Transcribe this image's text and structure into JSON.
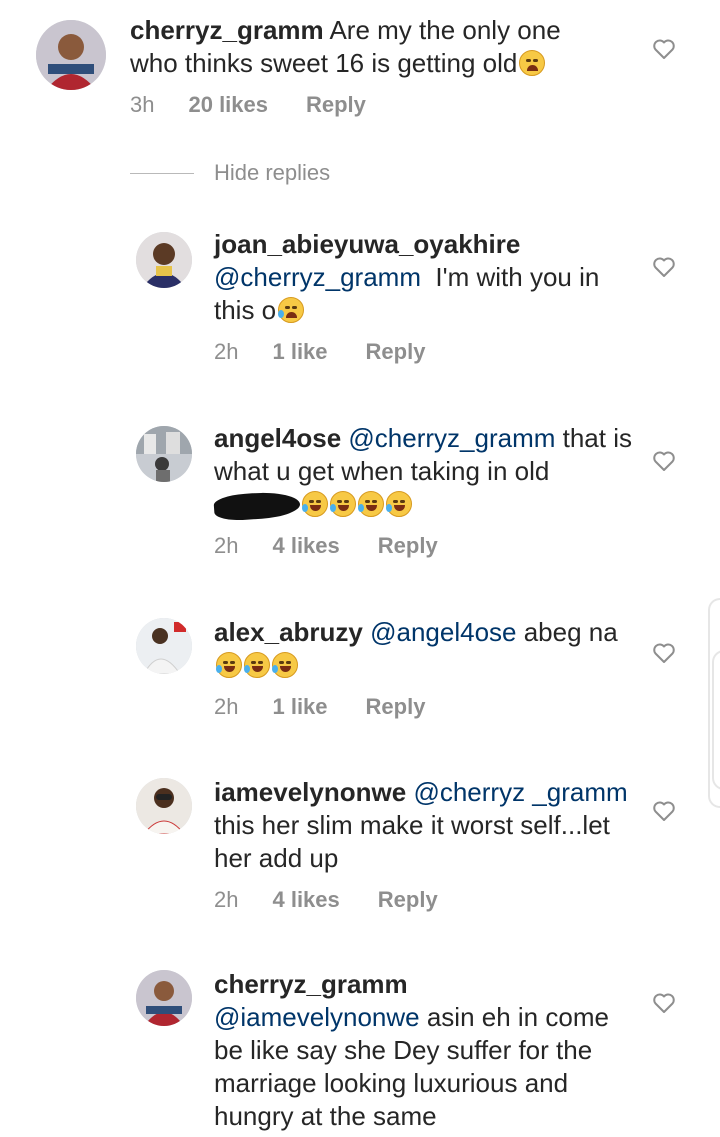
{
  "hide_replies": "Hide replies",
  "comments": [
    {
      "username": "cherryz_gramm",
      "mention": "",
      "text_before": " Are my the only one who thinks sweet 16 is getting old",
      "emoji": "tired-face",
      "time": "3h",
      "likes": "20 likes",
      "reply": "Reply"
    },
    {
      "username": "joan_abieyuwa_oyakhire",
      "mention": "@cherryz_gramm",
      "text_after": "  I'm with you in this o",
      "emoji": "crying-face",
      "time": "2h",
      "likes": "1 like",
      "reply": "Reply"
    },
    {
      "username": "angel4ose",
      "mention": "@cherryz_gramm",
      "text_after": " that is what u get when taking in old",
      "emoji": "rolling-laughing-face",
      "time": "2h",
      "likes": "4 likes",
      "reply": "Reply"
    },
    {
      "username": "alex_abruzy",
      "mention": "@angel4ose",
      "text_after": " abeg na",
      "emoji": "tears-of-joy-face",
      "time": "2h",
      "likes": "1 like",
      "reply": "Reply"
    },
    {
      "username": "iamevelynonwe",
      "mention": "@cherryz _gramm",
      "text_after": " this her slim make it worst self...let her add up",
      "time": "2h",
      "likes": "4 likes",
      "reply": "Reply"
    },
    {
      "username": "cherryz_gramm",
      "mention": "@iamevelynonwe",
      "text_after": " asin eh in come be like say she Dey suffer for the marriage looking luxurious and hungry at the same"
    }
  ],
  "colors": {
    "text": "#262626",
    "mention": "#003569",
    "meta": "#8e8e8e"
  }
}
